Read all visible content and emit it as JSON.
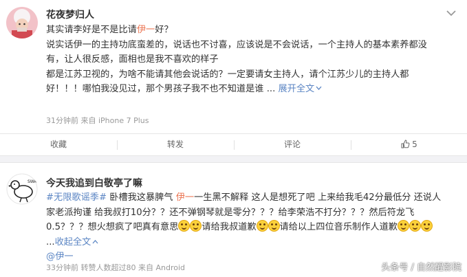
{
  "post1": {
    "username": "花夜梦归人",
    "line1_prefix": "其实请李好是不是比请",
    "line1_name": "伊一",
    "line1_suffix": "好？",
    "line2": "说实话伊一的主持功底蛮差的，说话也不讨喜，应该说是不会说话，一个主持人的基本素养都没",
    "line3": "有，让人很反感，面相也是我不喜欢的样子",
    "line4": "都是江苏卫视的，为啥不能请其他会说话的？一定要请女主持人，请个江苏少儿的主持人都",
    "line5": "好！！！哪怕我没见过，那个男孩子我不也不知道是谁 ...",
    "expand": "展开全文",
    "meta": "31分钟前 来自 iPhone 7 Plus",
    "actions": {
      "collect": "收藏",
      "repost": "转发",
      "comment": "评论",
      "like_count": "5"
    }
  },
  "post2": {
    "username": "今天我追到白敬亭了嘛",
    "topic": "#无限歌谣季#",
    "l1a": " 卧槽我这暴脾气 ",
    "l1name": "伊一",
    "l1b": "一生黑不解释 这人是想死了吧 上来给我毛42分最低分 还说人",
    "line2": "家老派拘谨 给我叔打10分？？还不弹钢琴就是零分？？？给李荣浩不打分？？？然后符龙飞",
    "l3a": "0.5？？？想火想疯了吧真有意思",
    "l3b": "请给我叔道歉",
    "l3c": "请给以上四位音乐制作人道歉",
    "line4_prefix": "...",
    "line4_collapse": "收起全文",
    "mention": "@伊一",
    "meta": "33分钟前 转赞人数超过80 来自 Android"
  },
  "watermark": "头条号 / 自然醒影院"
}
